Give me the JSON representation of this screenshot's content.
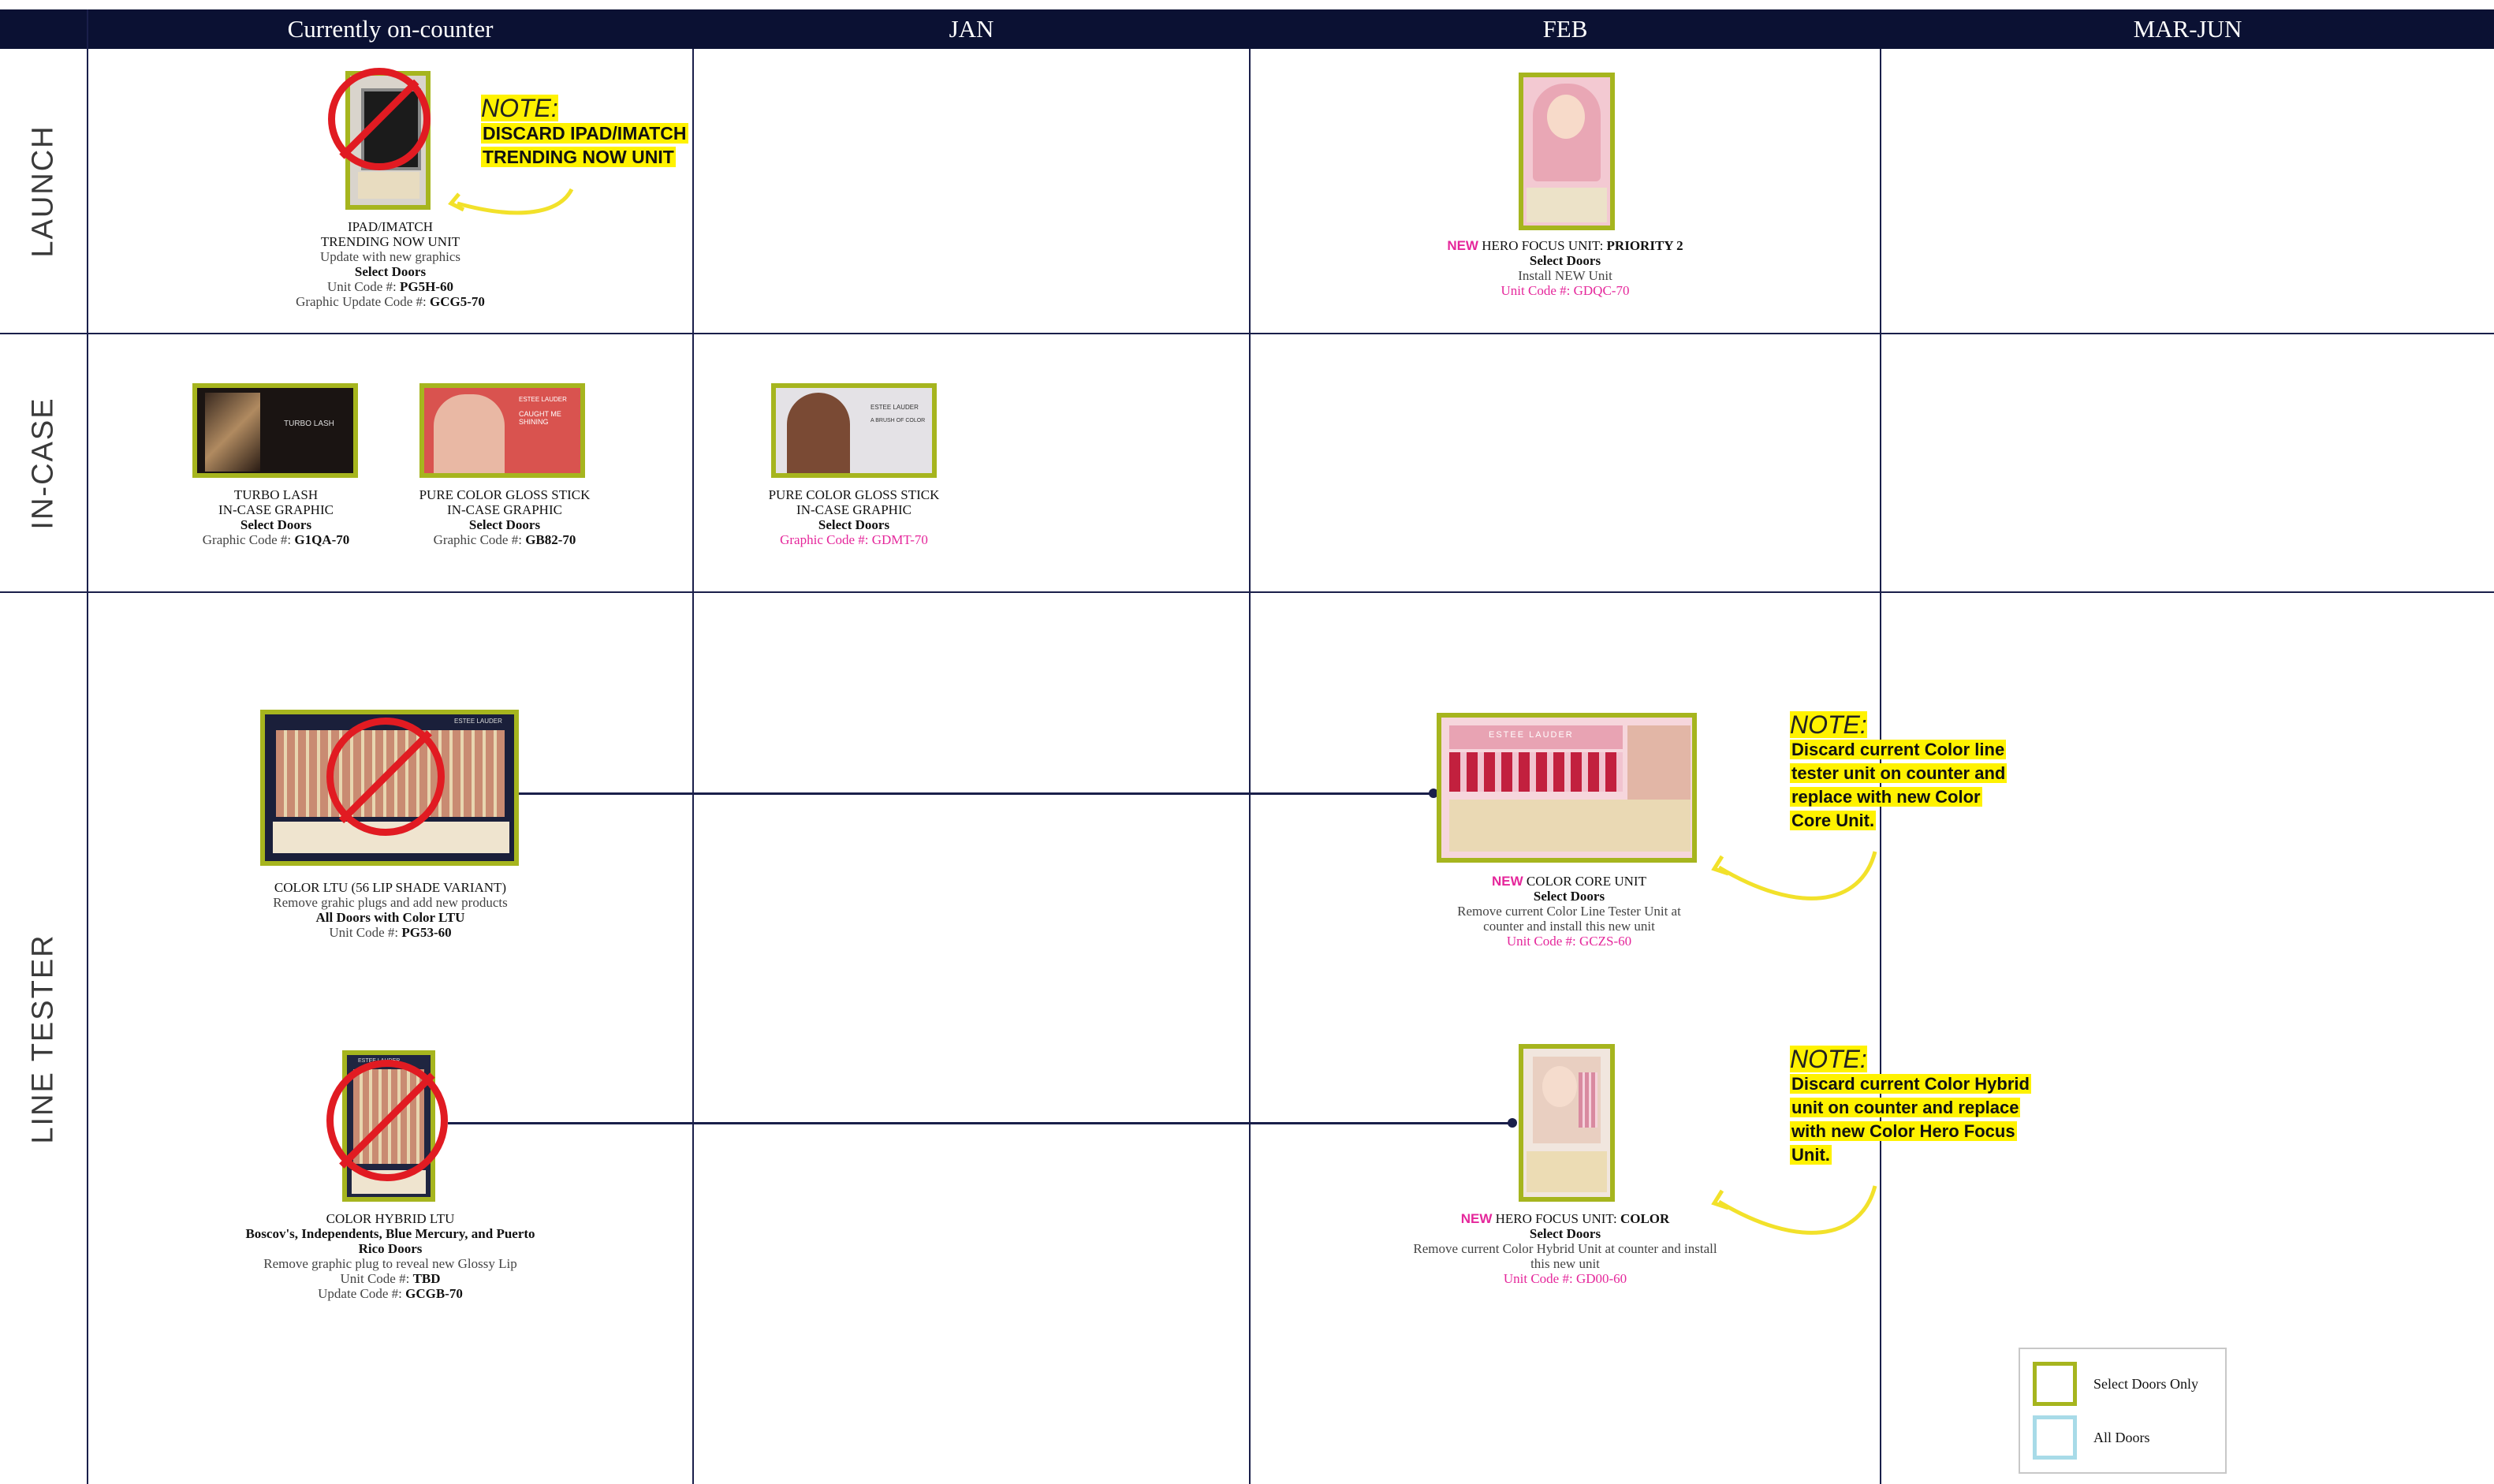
{
  "columns": [
    "Currently on-counter",
    "JAN",
    "FEB",
    "MAR-JUN"
  ],
  "rows": [
    "LAUNCH",
    "IN-CASE",
    "LINE TESTER"
  ],
  "colors": {
    "header_bg": "#0b1133",
    "select_doors": "#a6b51e",
    "all_doors": "#a8dbe8",
    "highlight": "#fff200",
    "new": "#e5279b",
    "discard": "#e11b22"
  },
  "launch": {
    "ipad": {
      "line1": "IPAD/IMATCH",
      "line2": "TRENDING NOW UNIT",
      "line3": "Update with new graphics",
      "doors": "Select Doors",
      "code_label": "Unit Code #:",
      "code": "PG5H-60",
      "gcode_label": "Graphic Update Code #:",
      "gcode": "GCG5-70",
      "discarded": true,
      "thumb_icon": "tablet-display-icon"
    },
    "note": {
      "title": "NOTE:",
      "body": "DISCARD IPAD/IMATCH TRENDING NOW UNIT"
    },
    "hero_p2": {
      "new": "NEW",
      "title": "HERO FOCUS UNIT:",
      "title_bold": "PRIORITY 2",
      "doors": "Select Doors",
      "action": "Install NEW Unit",
      "code_label": "Unit Code #:",
      "code": "GDQC-70"
    }
  },
  "incase": {
    "turbo": {
      "line1": "TURBO LASH",
      "line2": "IN-CASE GRAPHIC",
      "doors": "Select Doors",
      "code_label": "Graphic Code #:",
      "code": "G1QA-70"
    },
    "gloss1": {
      "line1": "PURE COLOR GLOSS STICK",
      "line2": "IN-CASE GRAPHIC",
      "doors": "Select Doors",
      "code_label": "Graphic Code #:",
      "code": "GB82-70"
    },
    "gloss2": {
      "line1": "PURE COLOR GLOSS STICK",
      "line2": "IN-CASE GRAPHIC",
      "doors": "Select Doors",
      "code_label": "Graphic Code #:",
      "code": "GDMT-70"
    }
  },
  "tester": {
    "color_ltu": {
      "line1": "COLOR LTU (56 LIP SHADE VARIANT)",
      "line2": "Remove grahic plugs and add new products",
      "doors": "All Doors with Color LTU",
      "code_label": "Unit Code #:",
      "code": "PG53-60",
      "discarded": true
    },
    "core": {
      "new": "NEW",
      "title": "COLOR CORE UNIT",
      "doors": "Select Doors",
      "action": "Remove current Color Line Tester Unit at counter and install this new unit",
      "code_label": "Unit Code #:",
      "code": "GCZS-60"
    },
    "note1": {
      "title": "NOTE:",
      "lines": [
        "Discard current Color line",
        "tester unit on counter and",
        "replace with new Color",
        "Core Unit."
      ]
    },
    "hybrid": {
      "line1": "COLOR HYBRID LTU",
      "doors": "Boscov's, Independents, Blue Mercury, and Puerto Rico Doors",
      "action": "Remove graphic plug to reveal new Glossy Lip",
      "code_label": "Unit Code #:",
      "code": "TBD",
      "ucode_label": "Update Code #:",
      "ucode": "GCGB-70",
      "discarded": true
    },
    "hero_color": {
      "new": "NEW",
      "title": "HERO FOCUS UNIT:",
      "title_bold": "COLOR",
      "doors": "Select Doors",
      "action": "Remove current Color Hybrid Unit at counter and install this new unit",
      "code_label": "Unit Code #:",
      "code": "GD00-60"
    },
    "note2": {
      "title": "NOTE:",
      "lines": [
        "Discard current Color Hybrid",
        "unit on counter and replace",
        "with new Color Hero Focus",
        "Unit."
      ]
    }
  },
  "thumb_text": {
    "turbo": "TURBO LASH",
    "gloss1": "ESTEE LAUDER",
    "gloss1b": "CAUGHT ME SHINING",
    "gloss2": "ESTEE LAUDER",
    "gloss2b": "A BRUSH OF COLOR",
    "core": "ESTEE LAUDER",
    "ltu": "ESTEE LAUDER",
    "hybrid": "ESTEE LAUDER"
  },
  "legend": {
    "select": "Select Doors Only",
    "all": "All Doors"
  }
}
